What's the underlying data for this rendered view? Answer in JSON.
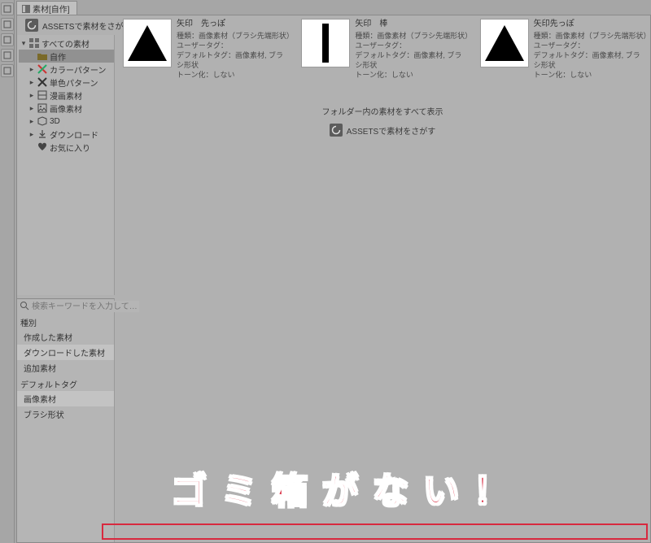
{
  "tab": {
    "label": "素材[自作]"
  },
  "assets_search_label": "ASSETSで素材をさがす",
  "sidebar": {
    "root": "すべての素材",
    "items": [
      {
        "label": "自作",
        "selected": true,
        "icon": "folder"
      },
      {
        "label": "カラーパターン",
        "icon": "x-color"
      },
      {
        "label": "単色パターン",
        "icon": "x-mono"
      },
      {
        "label": "漫画素材",
        "icon": "manga"
      },
      {
        "label": "画像素材",
        "icon": "image"
      },
      {
        "label": "3D",
        "icon": "cube"
      },
      {
        "label": "ダウンロード",
        "icon": "download"
      },
      {
        "label": "お気に入り",
        "icon": "heart"
      }
    ]
  },
  "search": {
    "placeholder": "検索キーワードを入力して…"
  },
  "filters": {
    "kind_head": "種別",
    "kind_items": [
      "作成した素材",
      "ダウンロードした素材",
      "追加素材"
    ],
    "tag_head": "デフォルトタグ",
    "tag_items": [
      "画像素材",
      "ブラシ形状"
    ]
  },
  "materials": [
    {
      "name": "矢印　先っぽ",
      "kind": "種類：画像素材（ブラシ先端形状）",
      "usertag": "ユーザータグ：",
      "deftag": "デフォルトタグ：画像素材, ブラシ形状",
      "tone": "トーン化：しない",
      "shape": "triangle"
    },
    {
      "name": "矢印　棒",
      "kind": "種類：画像素材（ブラシ先端形状）",
      "usertag": "ユーザータグ：",
      "deftag": "デフォルトタグ：画像素材, ブラシ形状",
      "tone": "トーン化：しない",
      "shape": "bar"
    },
    {
      "name": "矢印先っぽ",
      "kind": "種類：画像素材（ブラシ先端形状）",
      "usertag": "ユーザータグ：",
      "deftag": "デフォルトタグ：画像素材, ブラシ形状",
      "tone": "トーン化：しない",
      "shape": "triangle"
    }
  ],
  "mid": {
    "show_all": "フォルダー内の素材をすべて表示",
    "assets": "ASSETSで素材をさがす"
  },
  "annotation": "ゴミ箱がない！"
}
